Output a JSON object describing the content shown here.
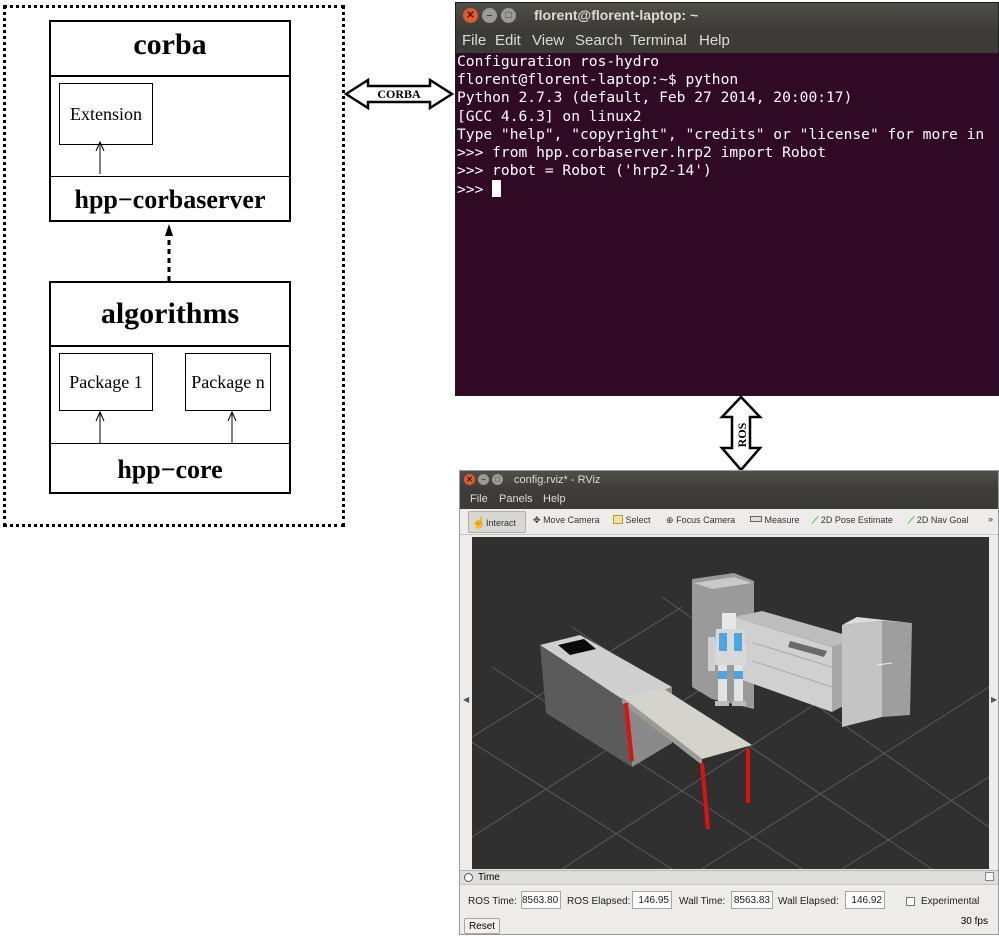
{
  "architecture": {
    "corba_module": {
      "title": "corba",
      "extension_label": "Extension",
      "footer": "hpp−corbaserver"
    },
    "algorithms_module": {
      "title": "algorithms",
      "package_1": "Package 1",
      "package_n": "Package n",
      "footer": "hpp−core"
    }
  },
  "links": {
    "corba_label": "CORBA",
    "ros_label": "ROS"
  },
  "terminal": {
    "title": "florent@florent-laptop: ~",
    "menu": [
      "File",
      "Edit",
      "View",
      "Search",
      "Terminal",
      "Help"
    ],
    "lines": [
      "Configuration ros-hydro",
      "florent@florent-laptop:~$ python",
      "Python 2.7.3 (default, Feb 27 2014, 20:00:17)",
      "[GCC 4.6.3] on linux2",
      "Type \"help\", \"copyright\", \"credits\" or \"license\" for more in",
      ">>> from hpp.corbaserver.hrp2 import Robot",
      ">>> robot = Robot ('hrp2-14')",
      ">>> "
    ],
    "colors": {
      "background": "#300a24",
      "text": "#ffffff"
    }
  },
  "rviz": {
    "title": "config.rviz* - RViz",
    "menu": [
      "File",
      "Panels",
      "Help"
    ],
    "tools": [
      "Interact",
      "Move Camera",
      "Select",
      "Focus Camera",
      "Measure",
      "2D Pose Estimate",
      "2D Nav Goal"
    ],
    "time_panel": {
      "header": "Time",
      "ros_time_label": "ROS Time:",
      "ros_time": "8563.80",
      "ros_elapsed_label": "ROS Elapsed:",
      "ros_elapsed": "146.95",
      "wall_time_label": "Wall Time:",
      "wall_time": "8563.83",
      "wall_elapsed_label": "Wall Elapsed:",
      "wall_elapsed": "146.92",
      "experimental_label": "Experimental"
    },
    "reset_label": "Reset",
    "fps": "30 fps"
  }
}
